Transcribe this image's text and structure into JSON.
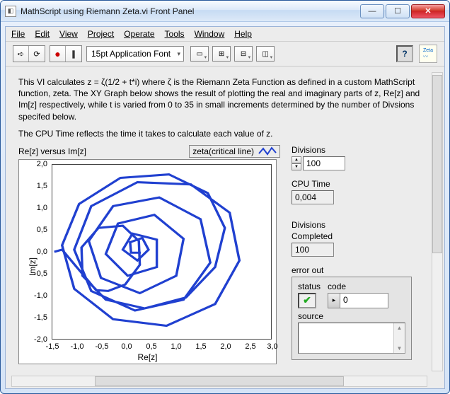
{
  "window": {
    "title": "MathScript using Riemann Zeta.vi Front Panel"
  },
  "menu": {
    "file": "File",
    "edit": "Edit",
    "view": "View",
    "project": "Project",
    "operate": "Operate",
    "tools": "Tools",
    "window": "Window",
    "help": "Help"
  },
  "toolbar": {
    "font": "15pt Application Font"
  },
  "desc": {
    "p1": "This VI calculates z = ζ(1/2 + t*i) where ζ is the Riemann Zeta Function as defined in a custom MathScript function, zeta. The XY Graph below shows the result of plotting the real and imaginary parts of z, Re[z] and Im[z] respectively, while t is varied from 0 to 35 in small increments determined by the number of Divsions specifed below.",
    "p2": "The CPU Time reflects the time it takes to calculate each value of z."
  },
  "graph": {
    "title": "Re[z] versus Im[z]",
    "legend": "zeta(critical line)",
    "xlabel": "Re[z]",
    "ylabel": "Im[z]",
    "xticks": [
      "-1,5",
      "-1,0",
      "-0,5",
      "0,0",
      "0,5",
      "1,0",
      "1,5",
      "2,0",
      "2,5",
      "3,0"
    ],
    "yticks": [
      "2,0",
      "1,5",
      "1,0",
      "0,5",
      "0,0",
      "-0,5",
      "-1,0",
      "-1,5",
      "-2,0"
    ]
  },
  "fields": {
    "divisions_label": "Divisions",
    "divisions": "100",
    "cpu_label": "CPU Time",
    "cpu": "0,004",
    "divcomp_label1": "Divisions",
    "divcomp_label2": "Completed",
    "divcomp": "100",
    "error_label": "error out",
    "status_label": "status",
    "code_label": "code",
    "code": "0",
    "source_label": "source"
  },
  "chart_data": {
    "type": "line",
    "title": "Re[z] versus Im[z]",
    "xlabel": "Re[z]",
    "ylabel": "Im[z]",
    "xlim": [
      -1.5,
      3.0
    ],
    "ylim": [
      -2.0,
      2.0
    ],
    "series": [
      {
        "name": "zeta(critical line)",
        "note": "parametric curve ζ(1/2 + t·i) for t in [0,35], spiraling around origin"
      }
    ]
  }
}
